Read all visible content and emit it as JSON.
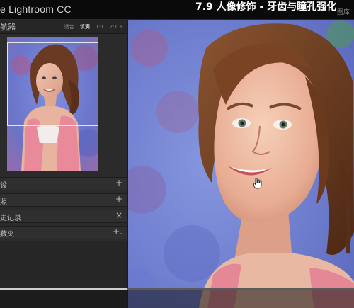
{
  "titlebar": {
    "app_title": "e Lightroom CC",
    "lesson_title": "7.9 人像修饰 - 牙齿与瞳孔强化",
    "corner_tag": "图库"
  },
  "navigator": {
    "title": "航器",
    "zoom_options": [
      "适合",
      "填满",
      "1:1",
      "2:1 ÷"
    ],
    "active_zoom": "填满"
  },
  "panels": [
    {
      "label": "设",
      "sign": "+"
    },
    {
      "label": "照",
      "sign": "+"
    },
    {
      "label": "史记录",
      "sign": "×"
    },
    {
      "label": "藏夹",
      "sign": "+."
    }
  ],
  "video": {
    "progress": 0.36
  }
}
